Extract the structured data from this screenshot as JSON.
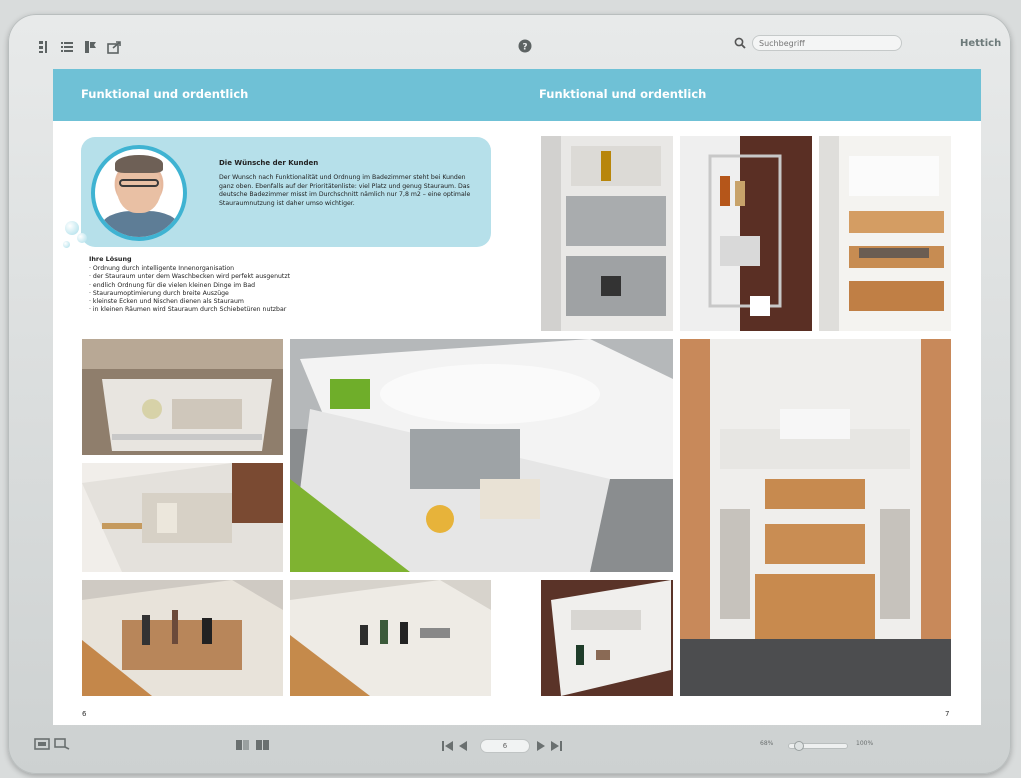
{
  "toolbar": {
    "icons": [
      "thumbnails-icon",
      "list-icon",
      "bookmark-icon",
      "share-icon",
      "help-icon"
    ],
    "search_placeholder": "Suchbegriff",
    "logo": "Hettich"
  },
  "spread": {
    "left_title": "Funktional und ordentlich",
    "right_title": "Funktional und ordentlich",
    "wish_title": "Die Wünsche der Kunden",
    "wish_body": "Der Wunsch nach Funktionalität und Ordnung im Badezimmer steht bei Kunden ganz oben. Ebenfalls auf der Prioritätenliste: viel Platz und genug Stauraum. Das deutsche Badezimmer misst im Durchschnitt nämlich nur 7,8 m2 – eine optimale Stauraumnutzung ist daher umso wichtiger.",
    "solution_title": "Ihre Lösung",
    "solution_items": [
      "· Ordnung durch intelligente Innenorganisation",
      "· der Stauraum unter dem Waschbecken wird perfekt ausgenutzt",
      "· endlich Ordnung für die vielen kleinen Dinge im Bad",
      "· Stauraumoptimierung durch breite Auszüge",
      "· kleinste Ecken und Nischen dienen als Stauraum",
      "· in kleinen Räumen wird Stauraum durch Schiebetüren nutzbar"
    ],
    "left_page_number": "6",
    "right_page_number": "7"
  },
  "bottombar": {
    "page_field": "6",
    "zoom_min": "68%",
    "zoom_max": "100%",
    "zoom_level": 0.1
  },
  "colors": {
    "header": "#6fc1d6",
    "bubble": "#b6e0ea",
    "accent": "#3fb3d2"
  }
}
